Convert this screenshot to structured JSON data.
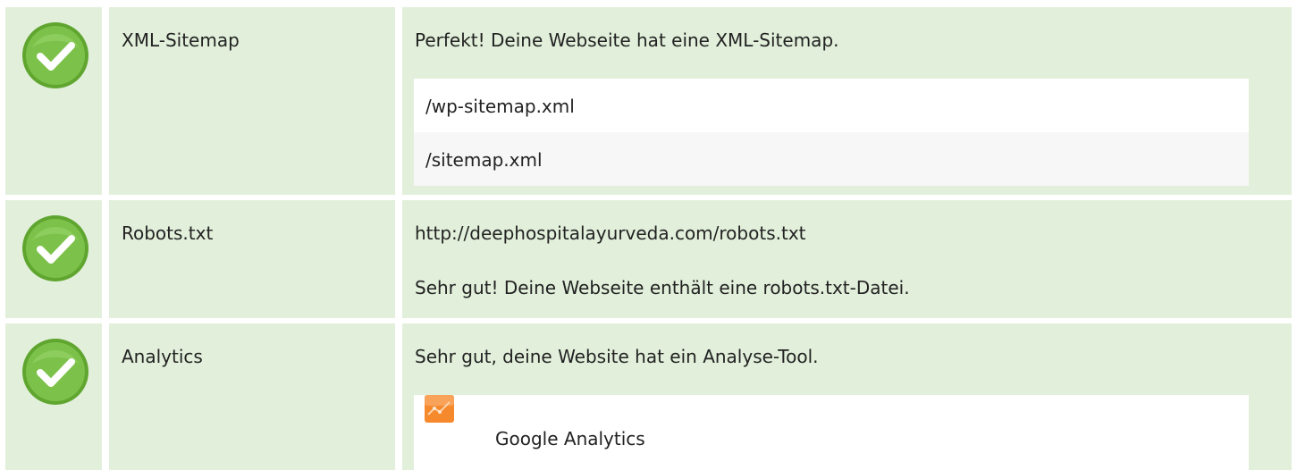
{
  "rows": [
    {
      "name": "XML-Sitemap",
      "status_icon": "check-circle-icon",
      "message": "Perfekt! Deine Webseite hat eine XML-Sitemap.",
      "sitemaps": [
        "/wp-sitemap.xml",
        "/sitemap.xml"
      ]
    },
    {
      "name": "Robots.txt",
      "status_icon": "check-circle-icon",
      "url": "http://deephospitalayurveda.com/robots.txt",
      "message": "Sehr gut! Deine Webseite enthält eine robots.txt-Datei."
    },
    {
      "name": "Analytics",
      "status_icon": "check-circle-icon",
      "message": "Sehr gut, deine Website hat ein Analyse-Tool.",
      "tools": [
        {
          "name": "Google Analytics",
          "icon": "google-analytics-icon"
        }
      ]
    }
  ],
  "colors": {
    "row_background": "#e2f0db",
    "check_green": "#6ab53a",
    "ga_orange": "#f6892b"
  }
}
